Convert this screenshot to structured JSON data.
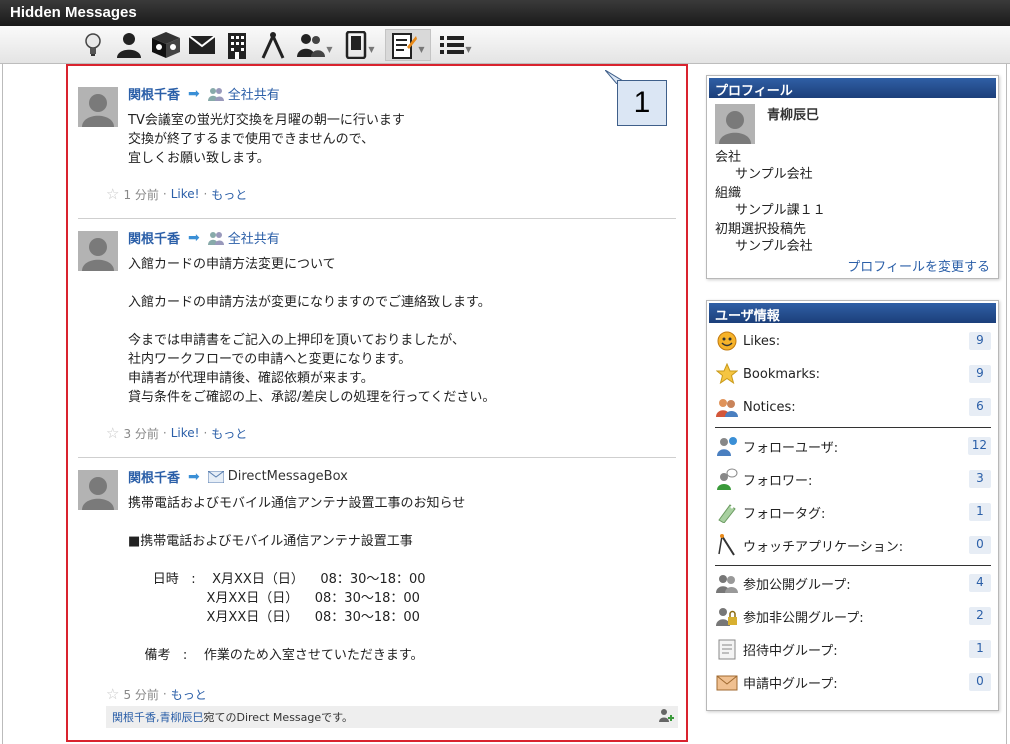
{
  "window": {
    "title": "Hidden Messages"
  },
  "posts": [
    {
      "user": "関根千香",
      "target": "全社共有",
      "body": "TV会議室の蛍光灯交換を月曜の朝一に行います\n交換が終了するまで使用できませんので、\n宜しくお願い致します。",
      "time": "1 分前",
      "like": "Like!",
      "more": "もっと"
    },
    {
      "user": "関根千香",
      "target": "全社共有",
      "body": "入館カードの申請方法変更について\n\n入館カードの申請方法が変更になりますのでご連絡致します。\n\n今までは申請書をご記入の上押印を頂いておりましたが、\n社内ワークフローでの申請へと変更になります。\n申請者が代理申請後、確認依頼が来ます。\n貸与条件をご確認の上、承認/差戻しの処理を行ってください。",
      "time": "3 分前",
      "like": "Like!",
      "more": "もっと"
    },
    {
      "user": "関根千香",
      "target": "DirectMessageBox",
      "body": "携帯電話およびモバイル通信アンテナ設置工事のお知らせ\n\n■携帯電話およびモバイル通信アンテナ設置工事\n\n      日時   :    X月XX日（日）    08：30〜18：00\n                   X月XX日（日）    08：30〜18：00\n                   X月XX日（日）    08：30〜18：00\n\n    備考   :    作業のため入室させていただきます。",
      "time": "5 分前",
      "more": "もっと",
      "dm_users": "関根千香,青柳辰巳",
      "dm_suffix": "宛てのDirect Messageです。"
    }
  ],
  "callout": {
    "label": "1"
  },
  "profile": {
    "header": "プロフィール",
    "name": "青柳辰巳",
    "company_label": "会社",
    "company": "サンプル会社",
    "org_label": "組織",
    "org": "サンプル課１１",
    "default_label": "初期選択投稿先",
    "default": "サンプル会社",
    "edit_link": "プロフィールを変更する"
  },
  "userinfo": {
    "header": "ユーザ情報",
    "rows": [
      {
        "label": "Likes:",
        "count": "9"
      },
      {
        "label": "Bookmarks:",
        "count": "9"
      },
      {
        "label": "Notices:",
        "count": "6"
      },
      {
        "label": "フォローユーザ:",
        "count": "12"
      },
      {
        "label": "フォロワー:",
        "count": "3"
      },
      {
        "label": "フォロータグ:",
        "count": "1"
      },
      {
        "label": "ウォッチアプリケーション:",
        "count": "0"
      },
      {
        "label": "参加公開グループ:",
        "count": "4"
      },
      {
        "label": "参加非公開グループ:",
        "count": "2"
      },
      {
        "label": "招待中グループ:",
        "count": "1"
      },
      {
        "label": "申請中グループ:",
        "count": "0"
      }
    ]
  },
  "colors": {
    "accent": "#2b5fa8",
    "highlight_border": "#d9232e",
    "panel_header": "#2f5fa5"
  }
}
